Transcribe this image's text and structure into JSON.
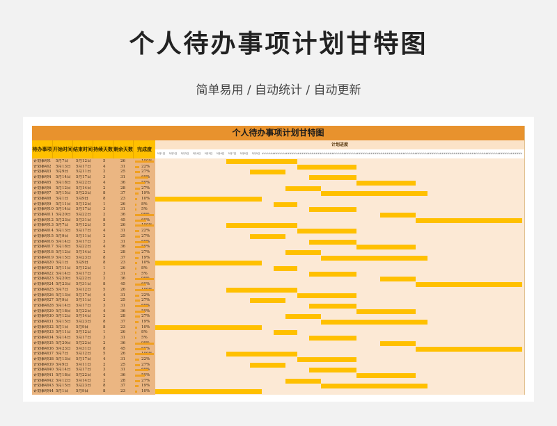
{
  "header": {
    "title": "个人待办事项计划甘特图",
    "subtitle": "简单易用 / 自动统计 / 自动更新"
  },
  "sheet": {
    "title": "个人待办事项计划甘特图",
    "columns": [
      "待办事项",
      "开始时间",
      "结束时间",
      "持续天数",
      "剩余天数",
      "完成度"
    ],
    "gantt_header": "计划进度",
    "dates": [
      "5月1日",
      "5月2日",
      "5月3日",
      "5月4日",
      "5月5日",
      "5月6日",
      "5月7日",
      "5月8日",
      "5月9日",
      "######",
      "######",
      "######",
      "######",
      "######",
      "######",
      "######",
      "######",
      "######",
      "######",
      "######",
      "######",
      "######",
      "######",
      "######",
      "######",
      "######",
      "######",
      "######",
      "######",
      "######",
      "######"
    ],
    "accent": "#ffc000",
    "title_bg": "#e8922d"
  },
  "tasks": [
    {
      "name": "计划事项1",
      "start": "5月7日",
      "end": "5月12日",
      "dur": "5",
      "rem": "26",
      "pct": "100%",
      "progress": 1.0,
      "bar_start": 6,
      "bar_len": 6
    },
    {
      "name": "计划事项2",
      "start": "5月13日",
      "end": "5月17日",
      "dur": "4",
      "rem": "31",
      "pct": "22%",
      "progress": 0.22,
      "bar_start": 12,
      "bar_len": 5
    },
    {
      "name": "计划事项3",
      "start": "5月9日",
      "end": "5月11日",
      "dur": "2",
      "rem": "25",
      "pct": "27%",
      "progress": 0.27,
      "bar_start": 8,
      "bar_len": 3
    },
    {
      "name": "计划事项4",
      "start": "5月14日",
      "end": "5月17日",
      "dur": "3",
      "rem": "31",
      "pct": "69%",
      "progress": 0.69,
      "bar_start": 13,
      "bar_len": 4
    },
    {
      "name": "计划事项5",
      "start": "5月18日",
      "end": "5月22日",
      "dur": "4",
      "rem": "36",
      "pct": "50%",
      "progress": 0.5,
      "bar_start": 17,
      "bar_len": 5
    },
    {
      "name": "计划事项6",
      "start": "5月12日",
      "end": "5月14日",
      "dur": "2",
      "rem": "28",
      "pct": "27%",
      "progress": 0.27,
      "bar_start": 11,
      "bar_len": 3
    },
    {
      "name": "计划事项7",
      "start": "5月15日",
      "end": "5月23日",
      "dur": "8",
      "rem": "37",
      "pct": "19%",
      "progress": 0.19,
      "bar_start": 14,
      "bar_len": 9
    },
    {
      "name": "计划事项8",
      "start": "5月1日",
      "end": "5月9日",
      "dur": "8",
      "rem": "23",
      "pct": "10%",
      "progress": 0.1,
      "bar_start": 0,
      "bar_len": 9
    },
    {
      "name": "计划事项9",
      "start": "5月11日",
      "end": "5月12日",
      "dur": "1",
      "rem": "26",
      "pct": "8%",
      "progress": 0.08,
      "bar_start": 10,
      "bar_len": 2
    },
    {
      "name": "计划事项10",
      "start": "5月14日",
      "end": "5月17日",
      "dur": "3",
      "rem": "31",
      "pct": "5%",
      "progress": 0.05,
      "bar_start": 13,
      "bar_len": 4
    },
    {
      "name": "计划事项11",
      "start": "5月20日",
      "end": "5月22日",
      "dur": "2",
      "rem": "36",
      "pct": "99%",
      "progress": 0.99,
      "bar_start": 19,
      "bar_len": 3
    },
    {
      "name": "计划事项12",
      "start": "5月23日",
      "end": "5月31日",
      "dur": "8",
      "rem": "45",
      "pct": "60%",
      "progress": 0.6,
      "bar_start": 22,
      "bar_len": 9
    },
    {
      "name": "计划事项13",
      "start": "5月7日",
      "end": "5月12日",
      "dur": "5",
      "rem": "26",
      "pct": "100%",
      "progress": 1.0,
      "bar_start": 6,
      "bar_len": 6
    },
    {
      "name": "计划事项14",
      "start": "5月13日",
      "end": "5月17日",
      "dur": "4",
      "rem": "31",
      "pct": "22%",
      "progress": 0.22,
      "bar_start": 12,
      "bar_len": 5
    },
    {
      "name": "计划事项15",
      "start": "5月9日",
      "end": "5月11日",
      "dur": "2",
      "rem": "25",
      "pct": "27%",
      "progress": 0.27,
      "bar_start": 8,
      "bar_len": 3
    },
    {
      "name": "计划事项16",
      "start": "5月14日",
      "end": "5月17日",
      "dur": "3",
      "rem": "31",
      "pct": "69%",
      "progress": 0.69,
      "bar_start": 13,
      "bar_len": 4
    },
    {
      "name": "计划事项17",
      "start": "5月18日",
      "end": "5月22日",
      "dur": "4",
      "rem": "36",
      "pct": "50%",
      "progress": 0.5,
      "bar_start": 17,
      "bar_len": 5
    },
    {
      "name": "计划事项18",
      "start": "5月12日",
      "end": "5月14日",
      "dur": "2",
      "rem": "28",
      "pct": "27%",
      "progress": 0.27,
      "bar_start": 11,
      "bar_len": 3
    },
    {
      "name": "计划事项19",
      "start": "5月15日",
      "end": "5月23日",
      "dur": "8",
      "rem": "37",
      "pct": "19%",
      "progress": 0.19,
      "bar_start": 14,
      "bar_len": 9
    },
    {
      "name": "计划事项20",
      "start": "5月1日",
      "end": "5月9日",
      "dur": "8",
      "rem": "23",
      "pct": "10%",
      "progress": 0.1,
      "bar_start": 0,
      "bar_len": 9
    },
    {
      "name": "计划事项21",
      "start": "5月11日",
      "end": "5月12日",
      "dur": "1",
      "rem": "26",
      "pct": "8%",
      "progress": 0.08,
      "bar_start": 10,
      "bar_len": 2
    },
    {
      "name": "计划事项22",
      "start": "5月14日",
      "end": "5月17日",
      "dur": "3",
      "rem": "31",
      "pct": "5%",
      "progress": 0.05,
      "bar_start": 13,
      "bar_len": 4
    },
    {
      "name": "计划事项23",
      "start": "5月20日",
      "end": "5月22日",
      "dur": "2",
      "rem": "36",
      "pct": "99%",
      "progress": 0.99,
      "bar_start": 19,
      "bar_len": 3
    },
    {
      "name": "计划事项24",
      "start": "5月23日",
      "end": "5月31日",
      "dur": "8",
      "rem": "45",
      "pct": "60%",
      "progress": 0.6,
      "bar_start": 22,
      "bar_len": 9
    },
    {
      "name": "计划事项25",
      "start": "5月7日",
      "end": "5月12日",
      "dur": "5",
      "rem": "26",
      "pct": "100%",
      "progress": 1.0,
      "bar_start": 6,
      "bar_len": 6
    },
    {
      "name": "计划事项26",
      "start": "5月13日",
      "end": "5月17日",
      "dur": "4",
      "rem": "31",
      "pct": "22%",
      "progress": 0.22,
      "bar_start": 12,
      "bar_len": 5
    },
    {
      "name": "计划事项27",
      "start": "5月9日",
      "end": "5月11日",
      "dur": "2",
      "rem": "25",
      "pct": "27%",
      "progress": 0.27,
      "bar_start": 8,
      "bar_len": 3
    },
    {
      "name": "计划事项28",
      "start": "5月14日",
      "end": "5月17日",
      "dur": "3",
      "rem": "31",
      "pct": "69%",
      "progress": 0.69,
      "bar_start": 13,
      "bar_len": 4
    },
    {
      "name": "计划事项29",
      "start": "5月18日",
      "end": "5月22日",
      "dur": "4",
      "rem": "36",
      "pct": "50%",
      "progress": 0.5,
      "bar_start": 17,
      "bar_len": 5
    },
    {
      "name": "计划事项30",
      "start": "5月12日",
      "end": "5月14日",
      "dur": "2",
      "rem": "28",
      "pct": "27%",
      "progress": 0.27,
      "bar_start": 11,
      "bar_len": 3
    },
    {
      "name": "计划事项31",
      "start": "5月15日",
      "end": "5月23日",
      "dur": "8",
      "rem": "37",
      "pct": "19%",
      "progress": 0.19,
      "bar_start": 14,
      "bar_len": 9
    },
    {
      "name": "计划事项32",
      "start": "5月1日",
      "end": "5月9日",
      "dur": "8",
      "rem": "23",
      "pct": "10%",
      "progress": 0.1,
      "bar_start": 0,
      "bar_len": 9
    },
    {
      "name": "计划事项33",
      "start": "5月11日",
      "end": "5月12日",
      "dur": "1",
      "rem": "26",
      "pct": "8%",
      "progress": 0.08,
      "bar_start": 10,
      "bar_len": 2
    },
    {
      "name": "计划事项34",
      "start": "5月14日",
      "end": "5月17日",
      "dur": "3",
      "rem": "31",
      "pct": "5%",
      "progress": 0.05,
      "bar_start": 13,
      "bar_len": 4
    },
    {
      "name": "计划事项35",
      "start": "5月20日",
      "end": "5月22日",
      "dur": "2",
      "rem": "36",
      "pct": "99%",
      "progress": 0.99,
      "bar_start": 19,
      "bar_len": 3
    },
    {
      "name": "计划事项36",
      "start": "5月23日",
      "end": "5月31日",
      "dur": "8",
      "rem": "45",
      "pct": "60%",
      "progress": 0.6,
      "bar_start": 22,
      "bar_len": 9
    },
    {
      "name": "计划事项37",
      "start": "5月7日",
      "end": "5月12日",
      "dur": "5",
      "rem": "26",
      "pct": "100%",
      "progress": 1.0,
      "bar_start": 6,
      "bar_len": 6
    },
    {
      "name": "计划事项38",
      "start": "5月13日",
      "end": "5月17日",
      "dur": "4",
      "rem": "31",
      "pct": "22%",
      "progress": 0.22,
      "bar_start": 12,
      "bar_len": 5
    },
    {
      "name": "计划事项39",
      "start": "5月9日",
      "end": "5月11日",
      "dur": "2",
      "rem": "25",
      "pct": "27%",
      "progress": 0.27,
      "bar_start": 8,
      "bar_len": 3
    },
    {
      "name": "计划事项40",
      "start": "5月14日",
      "end": "5月17日",
      "dur": "3",
      "rem": "31",
      "pct": "69%",
      "progress": 0.69,
      "bar_start": 13,
      "bar_len": 4
    },
    {
      "name": "计划事项41",
      "start": "5月18日",
      "end": "5月22日",
      "dur": "4",
      "rem": "36",
      "pct": "50%",
      "progress": 0.5,
      "bar_start": 17,
      "bar_len": 5
    },
    {
      "name": "计划事项42",
      "start": "5月12日",
      "end": "5月14日",
      "dur": "2",
      "rem": "28",
      "pct": "27%",
      "progress": 0.27,
      "bar_start": 11,
      "bar_len": 3
    },
    {
      "name": "计划事项43",
      "start": "5月15日",
      "end": "5月23日",
      "dur": "8",
      "rem": "37",
      "pct": "19%",
      "progress": 0.19,
      "bar_start": 14,
      "bar_len": 9
    },
    {
      "name": "计划事项44",
      "start": "5月1日",
      "end": "5月9日",
      "dur": "8",
      "rem": "23",
      "pct": "10%",
      "progress": 0.1,
      "bar_start": 0,
      "bar_len": 9
    }
  ]
}
